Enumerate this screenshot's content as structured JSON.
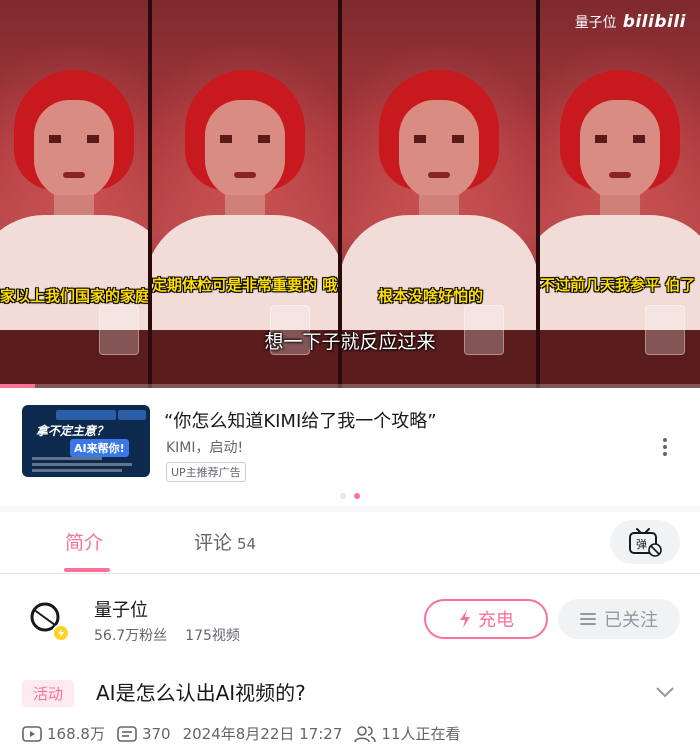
{
  "video": {
    "brand_name": "量子位",
    "brand_logo": "bilibili",
    "panel_subtitles": [
      "家以上我们国家的家庭",
      "定期体检可是非常重要的 哦",
      "根本没啥好怕的",
      "不过前几天我参平 伯了"
    ],
    "main_subtitle": "想一下子就反应过来",
    "progress": 0.05,
    "accent_color": "#fb7299"
  },
  "ad": {
    "title": "“你怎么知道KIMI给了我一个攻略”",
    "subtitle": "KIMI，启动!",
    "tag": "UP主推荐广告",
    "thumb_headline": "拿不定主意？",
    "thumb_answer": "AI来帮你!",
    "more_icon": "more-vertical-icon",
    "carousel_dots": 2,
    "carousel_active": 1
  },
  "tabs": {
    "intro_label": "简介",
    "comments_label": "评论",
    "comments_count": "54",
    "danmaku_icon": "danmaku-toggle-icon"
  },
  "uploader": {
    "name": "量子位",
    "fans": "56.7万粉丝",
    "videos": "175视频",
    "charge_label": "充电",
    "follow_label": "已关注"
  },
  "video_info": {
    "tag": "活动",
    "title": "AI是怎么认出AI视频的?",
    "views": "168.8万",
    "danmaku_count": "370",
    "date": "2024年8月22日 17:27",
    "watching": "11人正在看"
  }
}
